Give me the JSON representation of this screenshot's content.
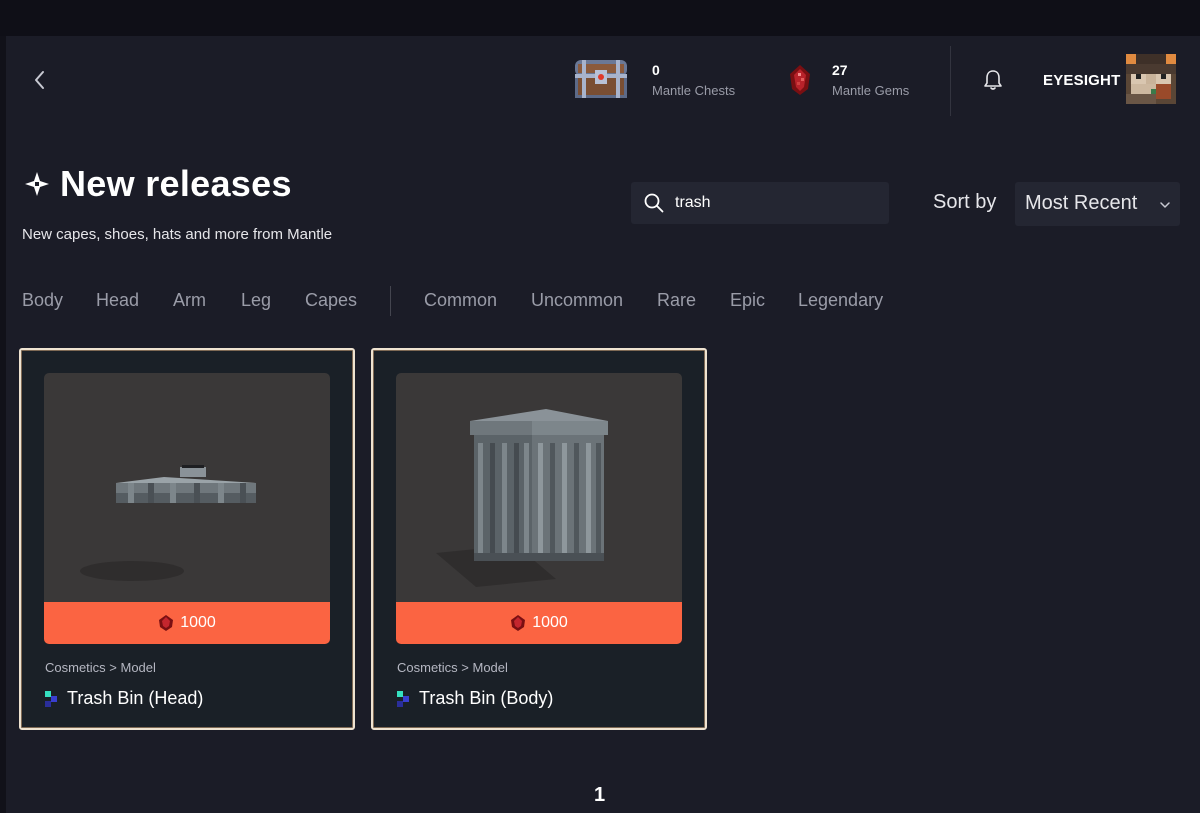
{
  "header": {
    "chests": {
      "value": "0",
      "label": "Mantle Chests",
      "icon": "chest-icon"
    },
    "gems": {
      "value": "27",
      "label": "Mantle Gems",
      "icon": "gem-icon"
    },
    "username": "EYESIGHT",
    "notification_icon": "bell-icon",
    "back_icon": "chevron-left-icon"
  },
  "section": {
    "title": "New releases",
    "subtitle": "New capes, shoes, hats and more from Mantle"
  },
  "search": {
    "value": "trash",
    "placeholder": ""
  },
  "sort": {
    "label": "Sort by",
    "value": "Most Recent"
  },
  "filters": {
    "types": [
      "Body",
      "Head",
      "Arm",
      "Leg",
      "Capes"
    ],
    "rarities": [
      "Common",
      "Uncommon",
      "Rare",
      "Epic",
      "Legendary"
    ]
  },
  "items": [
    {
      "category": "Cosmetics > Model",
      "name": "Trash Bin (Head)",
      "price": "1000"
    },
    {
      "category": "Cosmetics > Model",
      "name": "Trash Bin (Body)",
      "price": "1000"
    }
  ],
  "pagination": {
    "current": "1"
  },
  "colors": {
    "accent": "#fb6442",
    "card_border": "#efe3d1",
    "background": "#1b1c27",
    "muted_text": "#9a9ca8"
  }
}
